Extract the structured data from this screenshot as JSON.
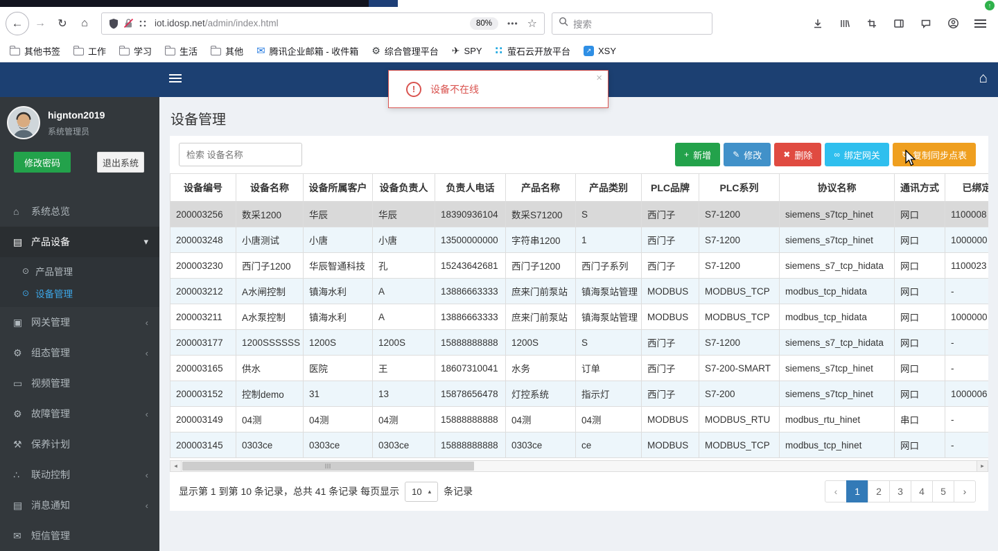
{
  "browser": {
    "back": "←",
    "forward": "→",
    "reload": "↻",
    "home": "⌂",
    "url_domain": "iot.idosp.net",
    "url_path": "/admin/index.html",
    "zoom": "80%",
    "page_actions": "•••",
    "bookmark_star": "☆",
    "search_placeholder": "搜索",
    "update_badge": "↑",
    "bookmarks": [
      {
        "label": "其他书签",
        "icon": "folder",
        "icon_name": "folder-icon"
      },
      {
        "label": "工作",
        "icon": "folder",
        "icon_name": "folder-icon"
      },
      {
        "label": "学习",
        "icon": "folder",
        "icon_name": "folder-icon"
      },
      {
        "label": "生活",
        "icon": "folder",
        "icon_name": "folder-icon"
      },
      {
        "label": "其他",
        "icon": "folder",
        "icon_name": "folder-icon"
      },
      {
        "label": "腾讯企业邮箱 - 收件箱",
        "icon": "mail",
        "icon_name": "mail-icon",
        "glyph": "✉"
      },
      {
        "label": "综合管理平台",
        "icon": "gear",
        "icon_name": "gear-icon",
        "glyph": "⚙"
      },
      {
        "label": "SPY",
        "icon": "plane",
        "icon_name": "plane-icon",
        "glyph": "✈"
      },
      {
        "label": "萤石云开放平台",
        "icon": "dots",
        "icon_name": "dots-icon",
        "glyph": "∷"
      },
      {
        "label": "XSY",
        "icon": "xsy",
        "icon_name": "arrow-square-icon",
        "glyph": "↗"
      }
    ]
  },
  "alert": {
    "message": "设备不在线",
    "close": "×"
  },
  "sidebar": {
    "username": "hignton2019",
    "role": "系统管理员",
    "change_password": "修改密码",
    "logout": "退出系统",
    "menu": [
      {
        "name": "system-overview",
        "label": "系统总览",
        "glyph": "⌂",
        "icon_name": "home-icon",
        "chevron": ""
      },
      {
        "name": "product-device",
        "label": "产品设备",
        "glyph": "▤",
        "icon_name": "book-icon",
        "chevron": "▾",
        "active": true,
        "children": [
          {
            "name": "product-management",
            "label": "产品管理",
            "active": false
          },
          {
            "name": "device-management",
            "label": "设备管理",
            "active": true
          }
        ]
      },
      {
        "name": "gateway-management",
        "label": "网关管理",
        "glyph": "▣",
        "icon_name": "id-card-icon",
        "chevron": "‹"
      },
      {
        "name": "scada-management",
        "label": "组态管理",
        "glyph": "⚙",
        "icon_name": "gears-icon",
        "chevron": "‹"
      },
      {
        "name": "video-management",
        "label": "视频管理",
        "glyph": "▭",
        "icon_name": "monitor-icon",
        "chevron": ""
      },
      {
        "name": "fault-management",
        "label": "故障管理",
        "glyph": "⚙",
        "icon_name": "gears-icon",
        "chevron": "‹"
      },
      {
        "name": "maintenance-plan",
        "label": "保养计划",
        "glyph": "⚒",
        "icon_name": "wrench-icon",
        "chevron": ""
      },
      {
        "name": "linkage-control",
        "label": "联动控制",
        "glyph": "∴",
        "icon_name": "sitemap-icon",
        "chevron": "‹"
      },
      {
        "name": "message-notification",
        "label": "消息通知",
        "glyph": "▤",
        "icon_name": "book-icon",
        "chevron": "‹"
      },
      {
        "name": "sms-management",
        "label": "短信管理",
        "glyph": "✉",
        "icon_name": "envelope-icon",
        "chevron": ""
      }
    ]
  },
  "page": {
    "title": "设备管理",
    "search_placeholder": "检索 设备名称",
    "buttons": [
      {
        "name": "add",
        "icon": "+",
        "icon_name": "plus-icon",
        "label": "新增",
        "bg": "#23a24b"
      },
      {
        "name": "edit",
        "icon": "✎",
        "icon_name": "pencil-icon",
        "label": "修改",
        "bg": "#4191c9"
      },
      {
        "name": "delete",
        "icon": "✖",
        "icon_name": "cross-icon",
        "label": "删除",
        "bg": "#e04b41"
      },
      {
        "name": "bind-gateway",
        "icon": "∞",
        "icon_name": "link-icon",
        "label": "绑定网关",
        "bg": "#2fbfee"
      },
      {
        "name": "copy-sync-points",
        "icon": "↻",
        "icon_name": "sync-icon",
        "label": "复制同步点表",
        "bg": "#ef9f1f"
      }
    ]
  },
  "table": {
    "columns": [
      "设备编号",
      "设备名称",
      "设备所属客户",
      "设备负责人",
      "负责人电话",
      "产品名称",
      "产品类别",
      "PLC品牌",
      "PLC系列",
      "协议名称",
      "通讯方式",
      "已绑定网关"
    ],
    "selected_row": 0,
    "rows": [
      [
        "200003256",
        "数采1200",
        "华辰",
        "华辰",
        "18390936104",
        "数采S71200",
        "S",
        "西门子",
        "S7-1200",
        "siemens_s7tcp_hinet",
        "网口",
        "1100008"
      ],
      [
        "200003248",
        "小唐测试",
        "小唐",
        "小唐",
        "13500000000",
        "字符串1200",
        "1",
        "西门子",
        "S7-1200",
        "siemens_s7tcp_hinet",
        "网口",
        "1000000"
      ],
      [
        "200003230",
        "西门子1200",
        "华辰智通科技",
        "孔",
        "15243642681",
        "西门子1200",
        "西门子系列",
        "西门子",
        "S7-1200",
        "siemens_s7_tcp_hidata",
        "网口",
        "1100023"
      ],
      [
        "200003212",
        "A水闸控制",
        "镇海水利",
        "A",
        "13886663333",
        "庶来门前泵站",
        "镇海泵站管理",
        "MODBUS",
        "MODBUS_TCP",
        "modbus_tcp_hidata",
        "网口",
        "-"
      ],
      [
        "200003211",
        "A水泵控制",
        "镇海水利",
        "A",
        "13886663333",
        "庶来门前泵站",
        "镇海泵站管理",
        "MODBUS",
        "MODBUS_TCP",
        "modbus_tcp_hidata",
        "网口",
        "1000000"
      ],
      [
        "200003177",
        "1200SSSSSS",
        "1200S",
        "1200S",
        "15888888888",
        "1200S",
        "S",
        "西门子",
        "S7-1200",
        "siemens_s7_tcp_hidata",
        "网口",
        "-"
      ],
      [
        "200003165",
        "供水",
        "医院",
        "王",
        "18607310041",
        "水务",
        "订单",
        "西门子",
        "S7-200-SMART",
        "siemens_s7tcp_hinet",
        "网口",
        "-"
      ],
      [
        "200003152",
        "控制demo",
        "31",
        "13",
        "15878656478",
        "灯控系统",
        "指示灯",
        "西门子",
        "S7-200",
        "siemens_s7tcp_hinet",
        "网口",
        "1000006"
      ],
      [
        "200003149",
        "04测",
        "04测",
        "04测",
        "15888888888",
        "04测",
        "04测",
        "MODBUS",
        "MODBUS_RTU",
        "modbus_rtu_hinet",
        "串口",
        "-"
      ],
      [
        "200003145",
        "0303ce",
        "0303ce",
        "0303ce",
        "15888888888",
        "0303ce",
        "ce",
        "MODBUS",
        "MODBUS_TCP",
        "modbus_tcp_hinet",
        "网口",
        "-"
      ]
    ]
  },
  "pager": {
    "info_left": "显示第 1 到第 10 条记录，总共 41 条记录 每页显示",
    "size": "10",
    "caret": "▴",
    "info_right": "条记录",
    "prev": "‹",
    "next": "›",
    "pages": [
      "1",
      "2",
      "3",
      "4",
      "5"
    ],
    "active": "1"
  }
}
